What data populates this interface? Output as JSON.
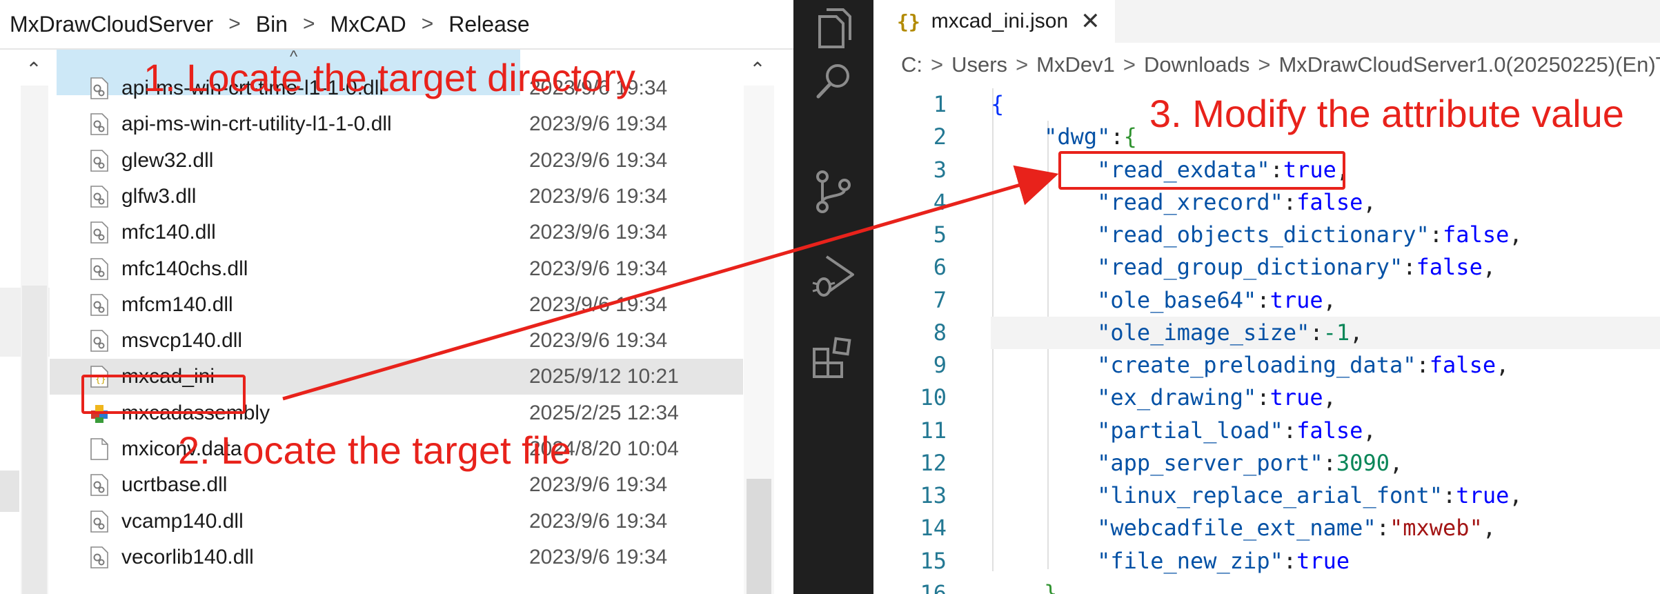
{
  "explorer": {
    "breadcrumb": [
      "MxDrawCloudServer",
      "Bin",
      "MxCAD",
      "Release"
    ],
    "files": [
      {
        "name": "api-ms-win-crt-time-l1-1-0.dll",
        "date": "2023/9/6 19:34",
        "icon": "dll-icon"
      },
      {
        "name": "api-ms-win-crt-utility-l1-1-0.dll",
        "date": "2023/9/6 19:34",
        "icon": "dll-icon"
      },
      {
        "name": "glew32.dll",
        "date": "2023/9/6 19:34",
        "icon": "dll-icon"
      },
      {
        "name": "glfw3.dll",
        "date": "2023/9/6 19:34",
        "icon": "dll-icon"
      },
      {
        "name": "mfc140.dll",
        "date": "2023/9/6 19:34",
        "icon": "dll-icon"
      },
      {
        "name": "mfc140chs.dll",
        "date": "2023/9/6 19:34",
        "icon": "dll-icon"
      },
      {
        "name": "mfcm140.dll",
        "date": "2023/9/6 19:34",
        "icon": "dll-icon"
      },
      {
        "name": "msvcp140.dll",
        "date": "2023/9/6 19:34",
        "icon": "dll-icon"
      },
      {
        "name": "mxcad_ini",
        "date": "2025/9/12 10:21",
        "icon": "json-file-icon"
      },
      {
        "name": "mxcadassembly",
        "date": "2025/2/25 12:34",
        "icon": "application-icon"
      },
      {
        "name": "mxiconv.data",
        "date": "2024/8/20 10:04",
        "icon": "blank-file-icon"
      },
      {
        "name": "ucrtbase.dll",
        "date": "2023/9/6 19:34",
        "icon": "dll-icon"
      },
      {
        "name": "vcamp140.dll",
        "date": "2023/9/6 19:34",
        "icon": "dll-icon"
      },
      {
        "name": "vecorlib140.dll",
        "date": "2023/9/6 19:34",
        "icon": "dll-icon"
      }
    ],
    "selected_index": 8
  },
  "activity_bar": {
    "icons": [
      "explorer-icon",
      "search-icon",
      "source-control-icon",
      "run-debug-icon",
      "extensions-icon"
    ]
  },
  "editor": {
    "tab": {
      "icon_text": "{}",
      "title": "mxcad_ini.json",
      "close": "✕"
    },
    "breadcrumb": [
      "C:",
      "Users",
      "MxDev1",
      "Downloads",
      "MxDrawCloudServer1.0(20250225)(En)T..."
    ],
    "current_line": 8,
    "lines": [
      {
        "n": "1",
        "tokens": [
          {
            "t": "{",
            "c": "brace"
          }
        ]
      },
      {
        "n": "2",
        "tokens": [
          {
            "t": "    ",
            "c": "punct"
          },
          {
            "t": "\"dwg\"",
            "c": "key"
          },
          {
            "t": ":",
            "c": "punct"
          },
          {
            "t": "{",
            "c": "brace2"
          }
        ]
      },
      {
        "n": "3",
        "tokens": [
          {
            "t": "        ",
            "c": "punct"
          },
          {
            "t": "\"read_exdata\"",
            "c": "key"
          },
          {
            "t": ":",
            "c": "punct"
          },
          {
            "t": "true",
            "c": "bool"
          },
          {
            "t": ",",
            "c": "punct"
          }
        ]
      },
      {
        "n": "4",
        "tokens": [
          {
            "t": "        ",
            "c": "punct"
          },
          {
            "t": "\"read_xrecord\"",
            "c": "key"
          },
          {
            "t": ":",
            "c": "punct"
          },
          {
            "t": "false",
            "c": "bool"
          },
          {
            "t": ",",
            "c": "punct"
          }
        ]
      },
      {
        "n": "5",
        "tokens": [
          {
            "t": "        ",
            "c": "punct"
          },
          {
            "t": "\"read_objects_dictionary\"",
            "c": "key"
          },
          {
            "t": ":",
            "c": "punct"
          },
          {
            "t": "false",
            "c": "bool"
          },
          {
            "t": ",",
            "c": "punct"
          }
        ]
      },
      {
        "n": "6",
        "tokens": [
          {
            "t": "        ",
            "c": "punct"
          },
          {
            "t": "\"read_group_dictionary\"",
            "c": "key"
          },
          {
            "t": ":",
            "c": "punct"
          },
          {
            "t": "false",
            "c": "bool"
          },
          {
            "t": ",",
            "c": "punct"
          }
        ]
      },
      {
        "n": "7",
        "tokens": [
          {
            "t": "        ",
            "c": "punct"
          },
          {
            "t": "\"ole_base64\"",
            "c": "key"
          },
          {
            "t": ":",
            "c": "punct"
          },
          {
            "t": "true",
            "c": "bool"
          },
          {
            "t": ",",
            "c": "punct"
          }
        ]
      },
      {
        "n": "8",
        "tokens": [
          {
            "t": "        ",
            "c": "punct"
          },
          {
            "t": "\"ole_image_size\"",
            "c": "key"
          },
          {
            "t": ":",
            "c": "punct"
          },
          {
            "t": "-1",
            "c": "num"
          },
          {
            "t": ",",
            "c": "punct"
          }
        ]
      },
      {
        "n": "9",
        "tokens": [
          {
            "t": "        ",
            "c": "punct"
          },
          {
            "t": "\"create_preloading_data\"",
            "c": "key"
          },
          {
            "t": ":",
            "c": "punct"
          },
          {
            "t": "false",
            "c": "bool"
          },
          {
            "t": ",",
            "c": "punct"
          }
        ]
      },
      {
        "n": "10",
        "tokens": [
          {
            "t": "        ",
            "c": "punct"
          },
          {
            "t": "\"ex_drawing\"",
            "c": "key"
          },
          {
            "t": ":",
            "c": "punct"
          },
          {
            "t": "true",
            "c": "bool"
          },
          {
            "t": ",",
            "c": "punct"
          }
        ]
      },
      {
        "n": "11",
        "tokens": [
          {
            "t": "        ",
            "c": "punct"
          },
          {
            "t": "\"partial_load\"",
            "c": "key"
          },
          {
            "t": ":",
            "c": "punct"
          },
          {
            "t": "false",
            "c": "bool"
          },
          {
            "t": ",",
            "c": "punct"
          }
        ]
      },
      {
        "n": "12",
        "tokens": [
          {
            "t": "        ",
            "c": "punct"
          },
          {
            "t": "\"app_server_port\"",
            "c": "key"
          },
          {
            "t": ":",
            "c": "punct"
          },
          {
            "t": "3090",
            "c": "num"
          },
          {
            "t": ",",
            "c": "punct"
          }
        ]
      },
      {
        "n": "13",
        "tokens": [
          {
            "t": "        ",
            "c": "punct"
          },
          {
            "t": "\"linux_replace_arial_font\"",
            "c": "key"
          },
          {
            "t": ":",
            "c": "punct"
          },
          {
            "t": "true",
            "c": "bool"
          },
          {
            "t": ",",
            "c": "punct"
          }
        ]
      },
      {
        "n": "14",
        "tokens": [
          {
            "t": "        ",
            "c": "punct"
          },
          {
            "t": "\"webcadfile_ext_name\"",
            "c": "key"
          },
          {
            "t": ":",
            "c": "punct"
          },
          {
            "t": "\"mxweb\"",
            "c": "str"
          },
          {
            "t": ",",
            "c": "punct"
          }
        ]
      },
      {
        "n": "15",
        "tokens": [
          {
            "t": "        ",
            "c": "punct"
          },
          {
            "t": "\"file_new_zip\"",
            "c": "key"
          },
          {
            "t": ":",
            "c": "punct"
          },
          {
            "t": "true",
            "c": "bool"
          }
        ]
      },
      {
        "n": "16",
        "tokens": [
          {
            "t": "    ",
            "c": "punct"
          },
          {
            "t": "}",
            "c": "brace2"
          }
        ]
      }
    ]
  },
  "annotations": {
    "step1": "1. Locate the target directory",
    "step2": "2. Locate the target file",
    "step3": "3. Modify the attribute value",
    "color": "#e8221b"
  }
}
